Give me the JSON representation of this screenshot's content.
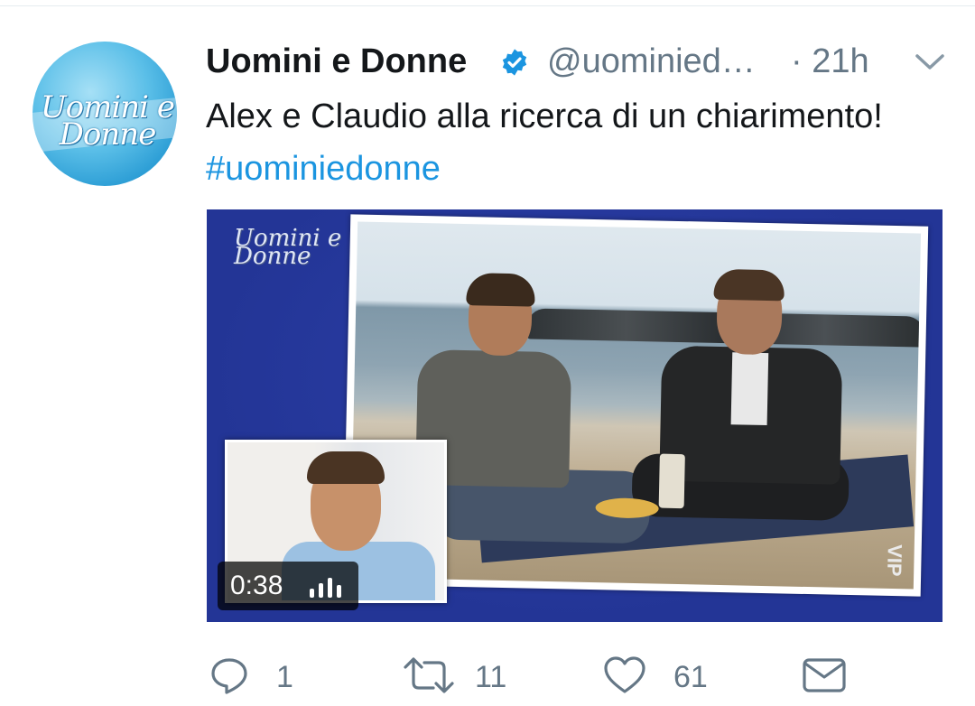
{
  "tweet": {
    "avatar_text": "Uomini e Donne",
    "display_name": "Uomini e Donne",
    "verified": true,
    "handle": "@uominied…",
    "time": "· 21h",
    "text": "Alex e Claudio alla ricerca di un chiarimento!",
    "hashtag": "#uominiedonne"
  },
  "media": {
    "logo_text": "Uomini e Donne",
    "watermark": "VIP",
    "duration": "0:38"
  },
  "actions": {
    "reply_count": "1",
    "retweet_count": "11",
    "like_count": "61"
  },
  "colors": {
    "link": "#1b95e0",
    "secondary_text": "#657786",
    "primary_text": "#14171a",
    "media_background": "#233596"
  },
  "icons": [
    "verified-badge-icon",
    "chevron-down-icon",
    "volume-bars-icon",
    "reply-icon",
    "retweet-icon",
    "like-icon",
    "message-icon"
  ]
}
